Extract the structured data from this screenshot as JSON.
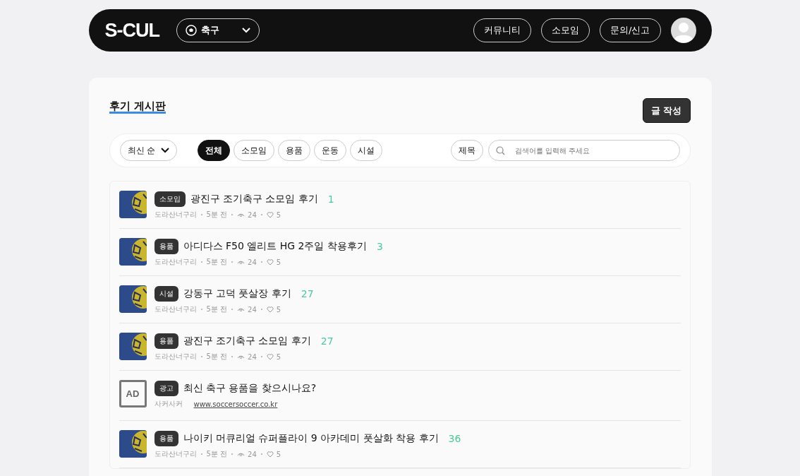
{
  "header": {
    "logo": "S-CUL",
    "sport_select": "축구",
    "nav": [
      "커뮤니티",
      "소모임",
      "문의/신고"
    ]
  },
  "board": {
    "title": "후기 게시판",
    "write_button": "글 작성",
    "sort_select": "최신 순",
    "categories": [
      {
        "label": "전체",
        "selected": true
      },
      {
        "label": "소모임",
        "selected": false
      },
      {
        "label": "용품",
        "selected": false
      },
      {
        "label": "운동",
        "selected": false
      },
      {
        "label": "시설",
        "selected": false
      }
    ],
    "search_scope": "제목",
    "search": {
      "placeholder": "검색어를 입력해 주세요"
    },
    "posts": [
      {
        "kind": "post",
        "tag": "소모임",
        "title": "광진구 조기축구 소모임 후기",
        "comments": "1",
        "author": "도라산너구리",
        "time": "5분 전",
        "views": "24",
        "likes": "5"
      },
      {
        "kind": "post",
        "tag": "용품",
        "title": "아디다스 F50 엘리트 HG 2주일 착용후기",
        "comments": "3",
        "author": "도라산너구리",
        "time": "5분 전",
        "views": "24",
        "likes": "5"
      },
      {
        "kind": "post",
        "tag": "시설",
        "title": "강동구 고덕 풋살장 후기",
        "comments": "27",
        "author": "도라산너구리",
        "time": "5분 전",
        "views": "24",
        "likes": "5"
      },
      {
        "kind": "post",
        "tag": "용품",
        "title": "광진구 조기축구 소모임 후기",
        "comments": "27",
        "author": "도라산너구리",
        "time": "5분 전",
        "views": "24",
        "likes": "5"
      },
      {
        "kind": "ad",
        "badge": "AD",
        "tag": "광고",
        "title": "최신 축구 용품을 찾으시나요?",
        "advertiser": "사커사커",
        "url": "www.soccersoccer.co.kr"
      },
      {
        "kind": "post",
        "tag": "용품",
        "title": "나이키 머큐리얼 슈퍼플라이 9 아카데미 풋살화 착용 후기",
        "comments": "36",
        "author": "도라산너구리",
        "time": "5분 전",
        "views": "24",
        "likes": "5"
      }
    ]
  }
}
